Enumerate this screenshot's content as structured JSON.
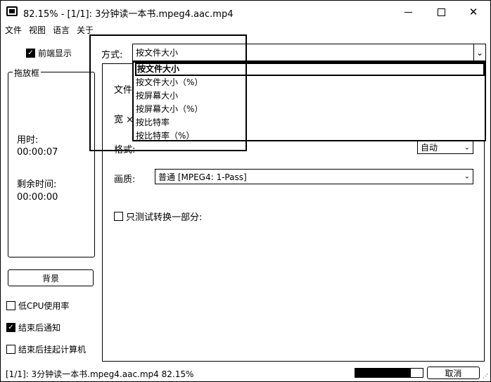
{
  "window": {
    "title": "82.15% - [1/1]: 3分钟读一本书.mpeg4.aac.mp4",
    "minimize_glyph": "—",
    "close_glyph": "✕"
  },
  "menu": [
    "文件",
    "视图",
    "语言",
    "关于"
  ],
  "left": {
    "topmost_label": "前端显示",
    "topmost_checked": true,
    "dropbox_title": "拖放框",
    "elapsed_label": "用时:",
    "elapsed_value": "00:00:07",
    "remaining_label": "剩余时间:",
    "remaining_value": "00:00:00",
    "background_button": "背景",
    "low_cpu_label": "低CPU使用率",
    "low_cpu_checked": false,
    "notify_label": "结束后通知",
    "notify_checked": true,
    "suspend_label": "结束后挂起计算机",
    "suspend_checked": false
  },
  "form": {
    "method_label": "方式:",
    "method_value": "按文件大小",
    "file_label": "文件",
    "width_label": "宽 ×",
    "format_label": "格式:",
    "format_value": "自动",
    "quality_label": "画质:",
    "quality_value": "普通  [MPEG4: 1-Pass]",
    "partial_label": "只测试转换一部分:",
    "partial_checked": false,
    "dropdown_arrow": "⌄"
  },
  "dropdown_options": [
    "按文件大小",
    "按文件大小（%）",
    "按屏幕大小",
    "按屏幕大小（%）",
    "按比特率",
    "按比特率（%）"
  ],
  "dropdown_selected_index": 0,
  "status": {
    "text": "[1/1]: 3分钟读一本书.mpeg4.aac.mp4  82.15%",
    "progress_percent": 82.15,
    "cancel_label": "取消"
  },
  "icons": {
    "check": "✓",
    "grip": "⋰"
  }
}
